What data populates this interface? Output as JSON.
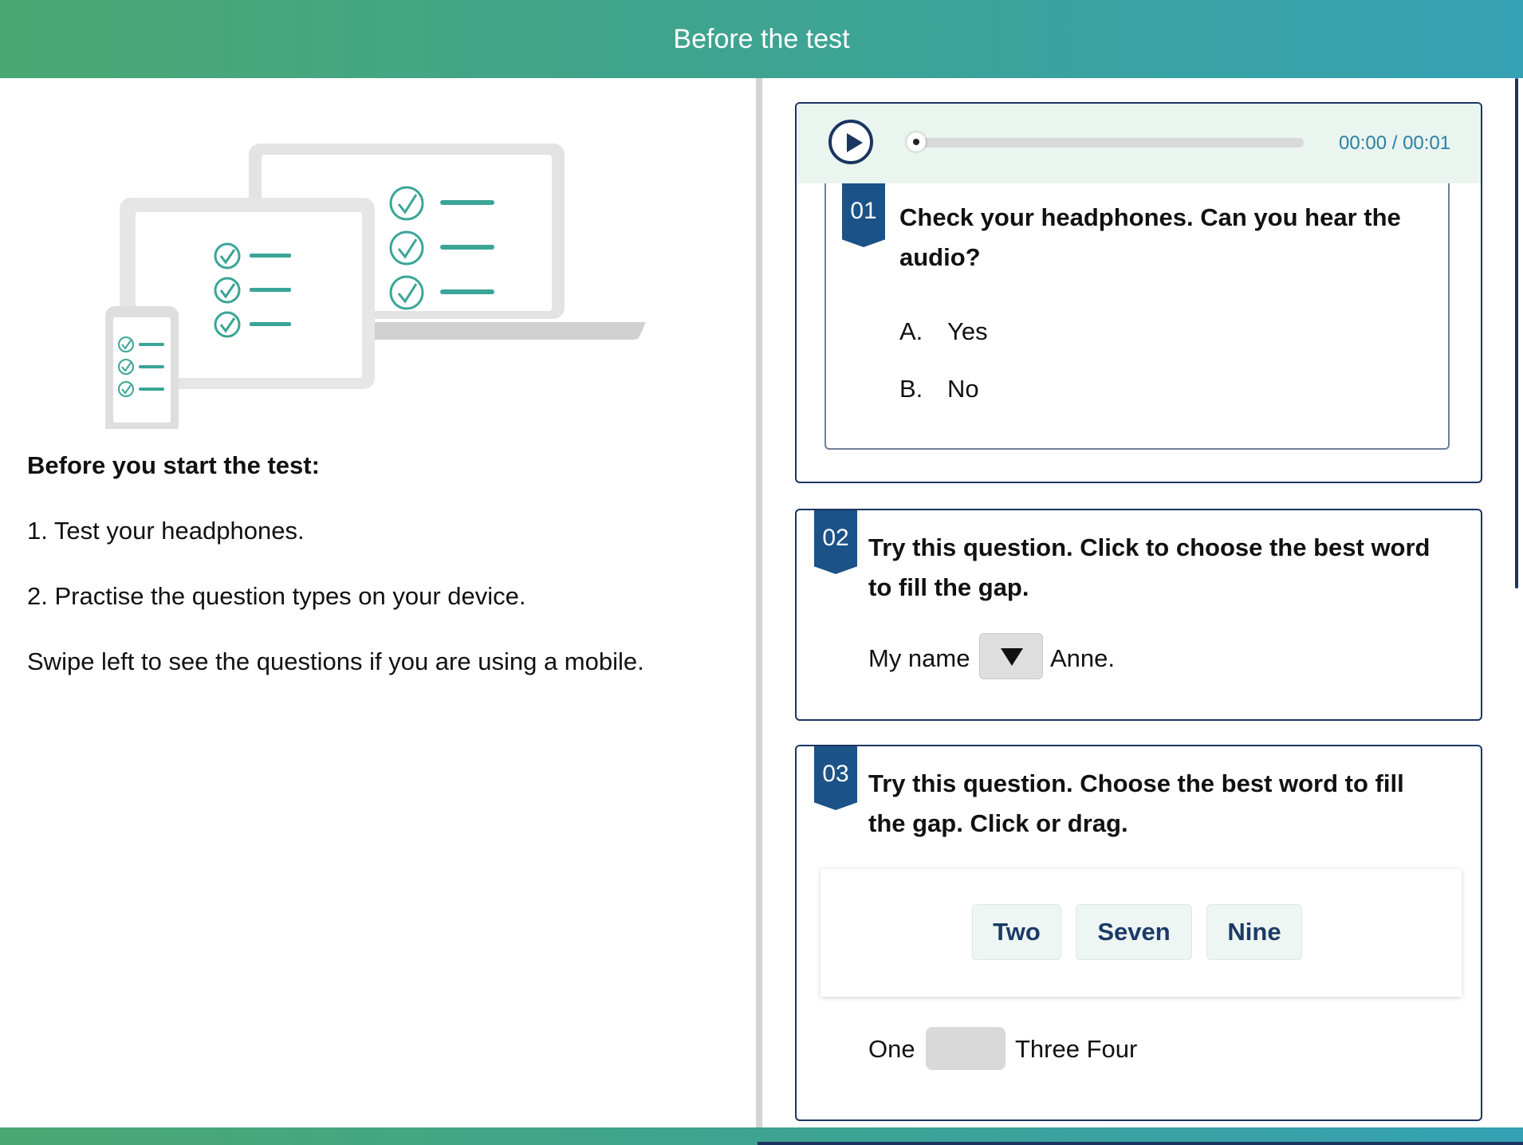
{
  "header": {
    "title": "Before the test"
  },
  "intro": {
    "title": "Before you start the test:",
    "lines": [
      "1. Test your headphones.",
      "2. Practise the question types on your device.",
      "Swipe left to see the questions if you are using a mobile."
    ]
  },
  "questions": [
    {
      "number": "01",
      "audio": {
        "time": "00:00 / 00:01",
        "progress": 0
      },
      "prompt_line1": "Check your headphones. Can you hear the",
      "prompt_line2": "audio?",
      "options": [
        {
          "letter": "A.",
          "text": "Yes"
        },
        {
          "letter": "B.",
          "text": "No"
        }
      ]
    },
    {
      "number": "02",
      "prompt_line1": "Try this question. Click to choose the best word",
      "prompt_line2": "to fill the gap.",
      "sentence_before": "My name",
      "sentence_after": "Anne."
    },
    {
      "number": "03",
      "prompt_line1": "Try this question. Choose the best word to fill",
      "prompt_line2": "the gap. Click or drag.",
      "choices": [
        "Two",
        "Seven",
        "Nine"
      ],
      "sentence_before": "One",
      "sentence_after": "Three Four"
    }
  ],
  "colors": {
    "header_gradient_start": "#4aa872",
    "header_gradient_end": "#35a1b4",
    "navy": "#1b3560",
    "badge": "#1b5288",
    "accent_teal": "#3aa597"
  }
}
